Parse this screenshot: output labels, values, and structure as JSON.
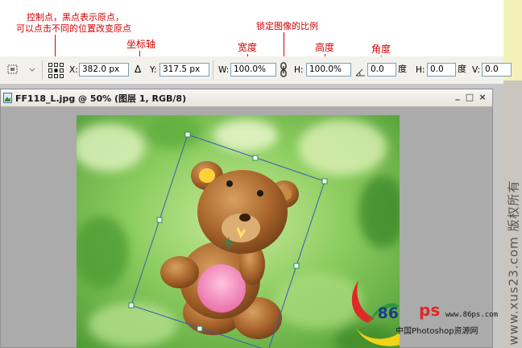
{
  "annotations": {
    "control_point": "控制点，黑点表示原点，",
    "control_point_2": "可以点击不同的位置改变原点",
    "coordinate_axis": "坐标轴",
    "lock_ratio": "锁定图像的比例",
    "width": "宽度",
    "height": "高度",
    "angle": "角度"
  },
  "options_bar": {
    "x_label": "X:",
    "x_value": "382.0 px",
    "delta_symbol": "Δ",
    "y_label": "Y:",
    "y_value": "317.5 px",
    "w_label": "W:",
    "w_value": "100.0%",
    "h_label": "H:",
    "h_value": "100.0%",
    "angle_value": "0.0",
    "angle_unit": "度",
    "skew_h_label": "H:",
    "skew_h_value": "0.0",
    "skew_h_unit": "度",
    "skew_v_label": "V:",
    "skew_v_value": "0.0"
  },
  "document": {
    "title": "FF118_L.jpg @ 50% (图层 1, RGB/8)",
    "minimize": "_",
    "maximize": "□",
    "close": "×"
  },
  "watermark": {
    "vertical": "www.xus23.com 版权所有",
    "site": "www.86ps.com",
    "brand": "中国Photoshop资源网",
    "logo_86": "86",
    "logo_ps": "ps"
  },
  "colors": {
    "annotation": "#d40000",
    "bear": "#a8652b",
    "belly": "#f07fb5",
    "handle": "#2e8b57",
    "bbox": "#3b5bb5"
  }
}
